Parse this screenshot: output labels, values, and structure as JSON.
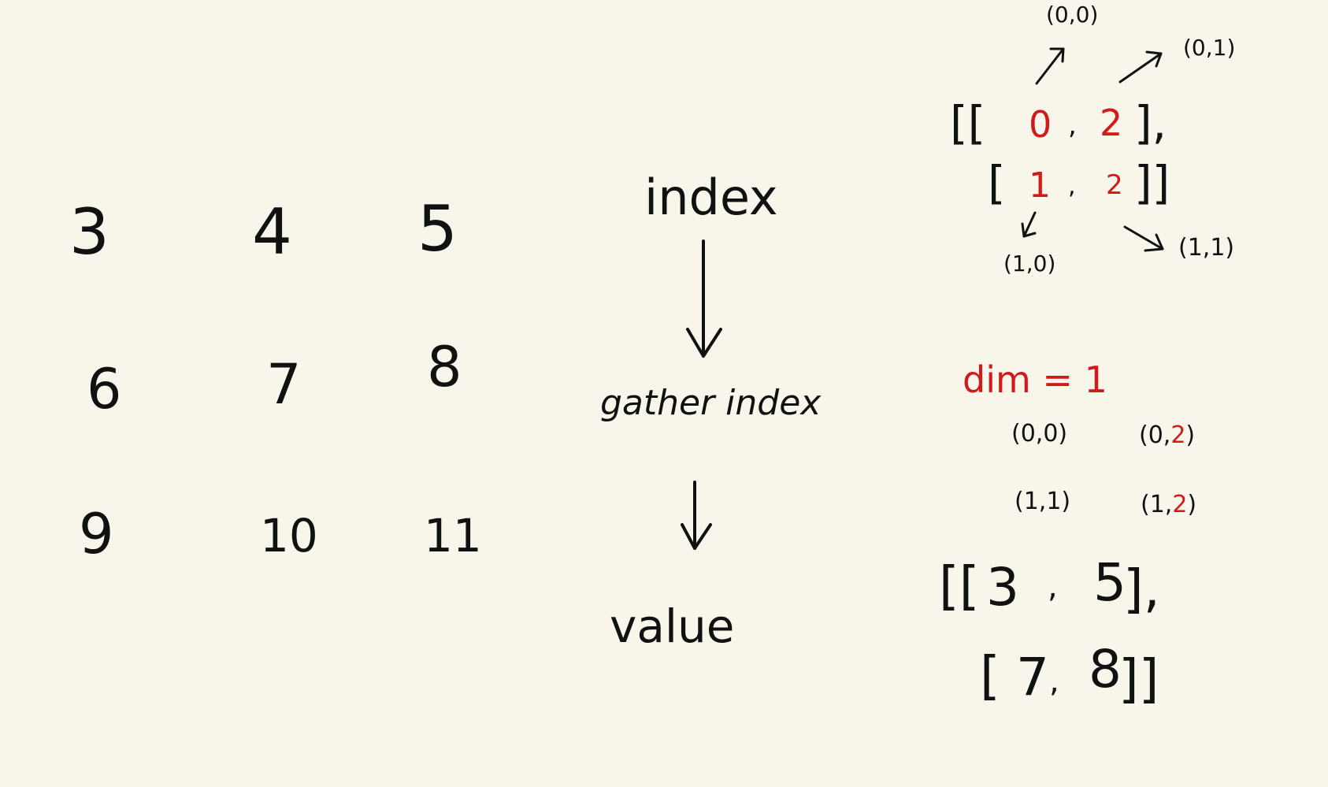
{
  "matrix": {
    "rows": [
      [
        "3",
        "4",
        "5"
      ],
      [
        "6",
        "7",
        "8"
      ],
      [
        "9",
        "10",
        "11"
      ]
    ]
  },
  "flow": {
    "step1": "index",
    "step2": "gather index",
    "step3": "value"
  },
  "index_notation": {
    "row1_open": "[[",
    "row1_a": "0",
    "row1_sep": ",",
    "row1_b": "2",
    "row1_close": "],",
    "row2_open": "[",
    "row2_a": "1",
    "row2_sep": ",",
    "row2_b": "2",
    "row2_close": "]]",
    "label_00": "(0,0)",
    "label_01": "(0,1)",
    "label_10": "(1,0)",
    "label_11": "(1,1)"
  },
  "dim": {
    "label": "dim = 1"
  },
  "gathered_coords": {
    "c00": "(0,0)",
    "c02_prefix": "(0,",
    "c02_red": "2",
    "c02_suffix": ")",
    "c11": "(1,1)",
    "c12_prefix": "(1,",
    "c12_red": "2",
    "c12_suffix": ")"
  },
  "result": {
    "row1_open": "[[",
    "row1_a": "3",
    "row1_sep": ",",
    "row1_b": "5",
    "row1_close": "],",
    "row2_open": "[",
    "row2_a": "7",
    "row2_sep": ",",
    "row2_b": "8",
    "row2_close": "]]"
  },
  "colors": {
    "ink": "#111111",
    "accent": "#d11a1a",
    "paper": "#f8f6eb"
  }
}
